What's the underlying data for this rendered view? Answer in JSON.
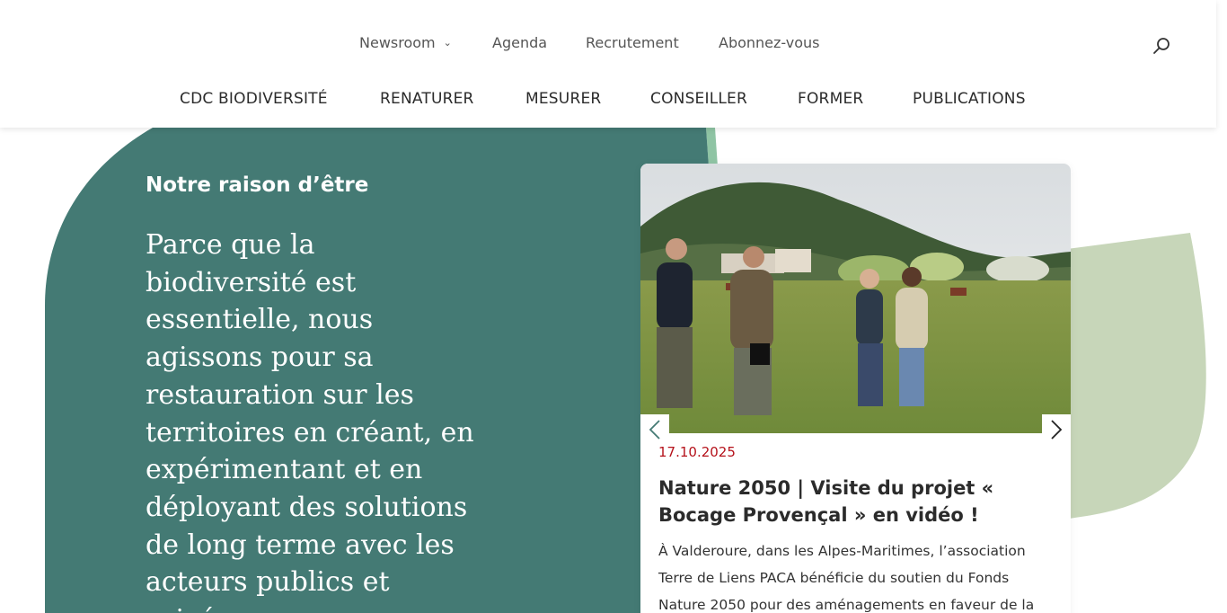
{
  "header": {
    "top_nav": [
      {
        "label": "Newsroom",
        "has_dropdown": true
      },
      {
        "label": "Agenda"
      },
      {
        "label": "Recrutement"
      },
      {
        "label": "Abonnez-vous"
      }
    ],
    "main_nav": [
      {
        "label": "CDC BIODIVERSITÉ"
      },
      {
        "label": "RENATURER"
      },
      {
        "label": "MESURER"
      },
      {
        "label": "CONSEILLER"
      },
      {
        "label": "FORMER"
      },
      {
        "label": "PUBLICATIONS"
      }
    ],
    "search_icon": "search-icon"
  },
  "hero": {
    "title": "Notre raison d’être",
    "text": "Parce que la biodiversité est essentielle, nous agissons pour sa restauration sur les territoires en créant, en expérimentant et en déployant des solutions de long terme avec les acteurs publics et privés."
  },
  "news_card": {
    "date": "17.10.2025",
    "title": "Nature 2050 | Visite du projet « Bocage Provençal » en vidéo !",
    "excerpt": "À Valderoure, dans les Alpes-Maritimes, l’association Terre de Liens PACA bénéficie du soutien du Fonds Nature 2050 pour des aménagements en faveur de la",
    "prev_icon": "chevron-left-icon",
    "next_icon": "chevron-right-icon"
  },
  "colors": {
    "hero_green": "#447a74",
    "leaf_light": "#c7d6b9",
    "date_red": "#b5121b",
    "accent_teal": "#8fc4a4"
  }
}
